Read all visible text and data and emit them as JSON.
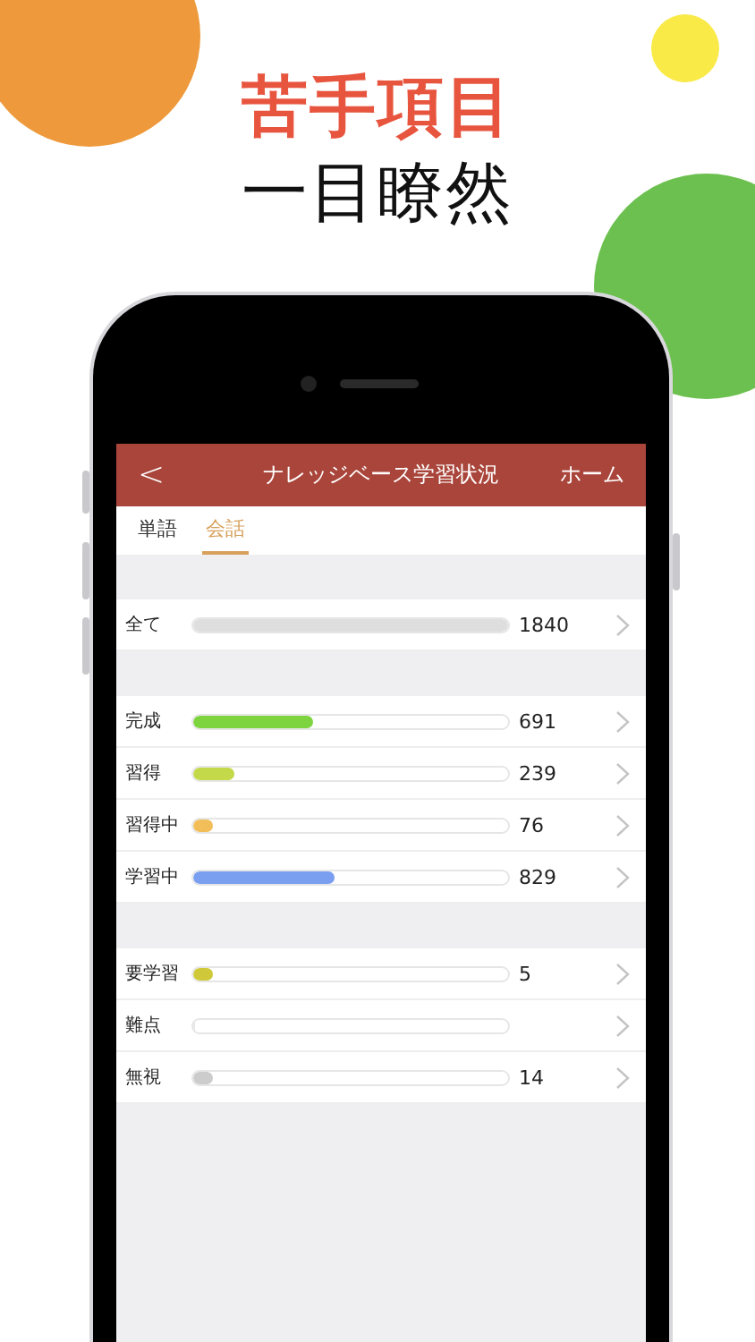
{
  "headline": {
    "emphasis": "苦手項目",
    "title": "一目瞭然"
  },
  "app": {
    "header": {
      "back": "<",
      "title": "ナレッジベース学習状況",
      "home": "ホーム"
    },
    "tabs": [
      {
        "label": "単語",
        "selected": false
      },
      {
        "label": "会話",
        "selected": true
      }
    ],
    "sections": [
      {
        "rows": [
          {
            "label": "全て",
            "level": 1,
            "color": "#dedede",
            "count": "1840"
          }
        ]
      },
      {
        "rows": [
          {
            "label": "完成",
            "level": 0.38,
            "color": "#7ed43f",
            "count": "691"
          },
          {
            "label": "習得",
            "level": 0.13,
            "color": "#c3d94a",
            "count": "239"
          },
          {
            "label": "習得中",
            "level": 0.04,
            "color": "#f2be5a",
            "count": "76"
          },
          {
            "label": "学習中",
            "level": 0.45,
            "color": "#7b9ff0",
            "count": "829"
          }
        ]
      },
      {
        "rows": [
          {
            "label": "要学習",
            "level": 0.04,
            "color": "#cfc838",
            "count": "5"
          },
          {
            "label": "難点",
            "level": 0
          },
          {
            "label": "無視",
            "level": 0.04,
            "color": "#cccccc",
            "count": "14"
          }
        ]
      }
    ]
  }
}
